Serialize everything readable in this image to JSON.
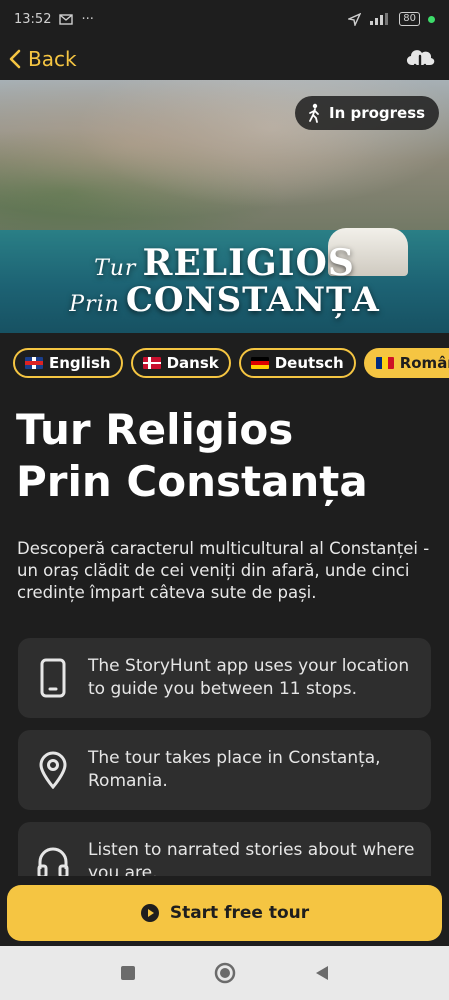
{
  "status_bar": {
    "time": "13:52",
    "battery": "80"
  },
  "header": {
    "back_label": "Back"
  },
  "hero": {
    "title_small_1": "Tur",
    "title_big_1": "RELIGIOS",
    "title_small_2": "Prin",
    "title_big_2": "CONSTANȚA",
    "status_badge": "In progress"
  },
  "languages": [
    {
      "label": "English",
      "flag": "uk"
    },
    {
      "label": "Dansk",
      "flag": "dk"
    },
    {
      "label": "Deutsch",
      "flag": "de"
    },
    {
      "label": "Română",
      "flag": "ro",
      "active": true
    }
  ],
  "tour": {
    "title_line_1": "Tur Religios",
    "title_line_2": "Prin Constanța",
    "description": "Descoperă caracterul multicultural al Constanței - un oraș clădit de cei veniți din afară, unde cinci credințe împart câteva sute de pași."
  },
  "info_cards": [
    {
      "icon": "phone-icon",
      "text": "The StoryHunt app uses your location to guide you between 11 stops."
    },
    {
      "icon": "location-pin-icon",
      "text": "The tour takes place in Constanța, Romania."
    },
    {
      "icon": "headphones-icon",
      "text": "Listen to narrated stories about where you are."
    }
  ],
  "cta": {
    "label": "Start free tour"
  },
  "colors": {
    "accent": "#f5c542",
    "background": "#1e1e1e",
    "card": "#2e2e2e"
  }
}
